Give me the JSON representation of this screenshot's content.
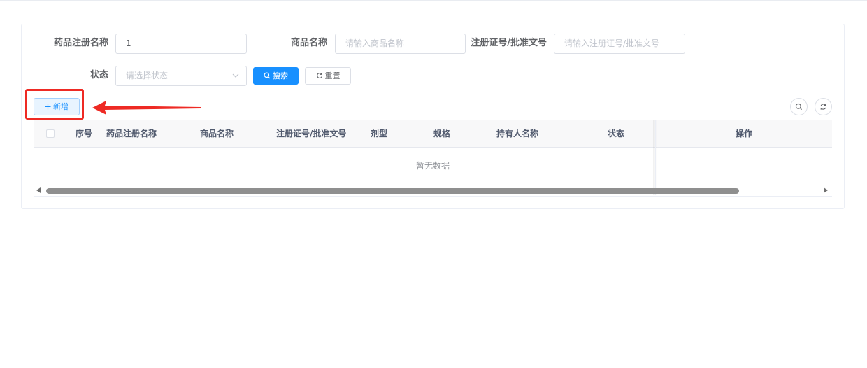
{
  "filters": {
    "drug_reg_name": {
      "label": "药品注册名称",
      "value": "1"
    },
    "product_name": {
      "label": "商品名称",
      "placeholder": "请输入商品名称"
    },
    "license_no": {
      "label": "注册证号/批准文号",
      "placeholder": "请输入注册证号/批准文号"
    },
    "status": {
      "label": "状态",
      "placeholder": "请选择状态"
    }
  },
  "buttons": {
    "search": "搜索",
    "reset": "重置",
    "add": "新增"
  },
  "table": {
    "columns": [
      "序号",
      "药品注册名称",
      "商品名称",
      "注册证号/批准文号",
      "剂型",
      "规格",
      "持有人名称",
      "状态",
      "操作"
    ],
    "empty_text": "暂无数据"
  },
  "annotation": {
    "color": "#ee2a24"
  },
  "colors": {
    "primary": "#1890ff"
  },
  "icons": {
    "search": "search-icon",
    "reset": "refresh-icon",
    "add": "plus-icon",
    "toolbar_search": "search-icon",
    "toolbar_refresh": "refresh-icon"
  }
}
